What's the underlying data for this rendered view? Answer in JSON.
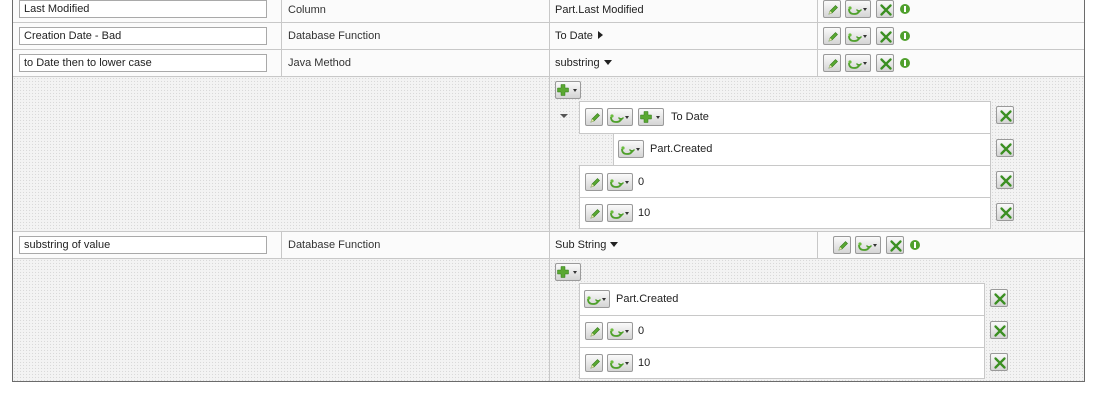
{
  "rows": [
    {
      "name": "Last Modified",
      "type": "Column",
      "value": "Part.Last Modified"
    },
    {
      "name": "Creation Date - Bad",
      "type": "Database Function",
      "value": "To Date"
    },
    {
      "name": "to Date then to lower case",
      "type": "Java Method",
      "value": "substring"
    },
    {
      "name": "substring of value",
      "type": "Database Function",
      "value": "Sub String"
    }
  ],
  "params1": {
    "func": "To Date",
    "col": "Part.Created",
    "arg1": "0",
    "arg2": "10"
  },
  "params2": {
    "col": "Part.Created",
    "arg1": "0",
    "arg2": "10"
  },
  "icons": {
    "edit": "pencil-icon",
    "link": "link-icon",
    "remove": "close-icon",
    "info": "info-icon",
    "add": "plus-icon"
  },
  "colors": {
    "icon_green": "#4fa02c"
  }
}
